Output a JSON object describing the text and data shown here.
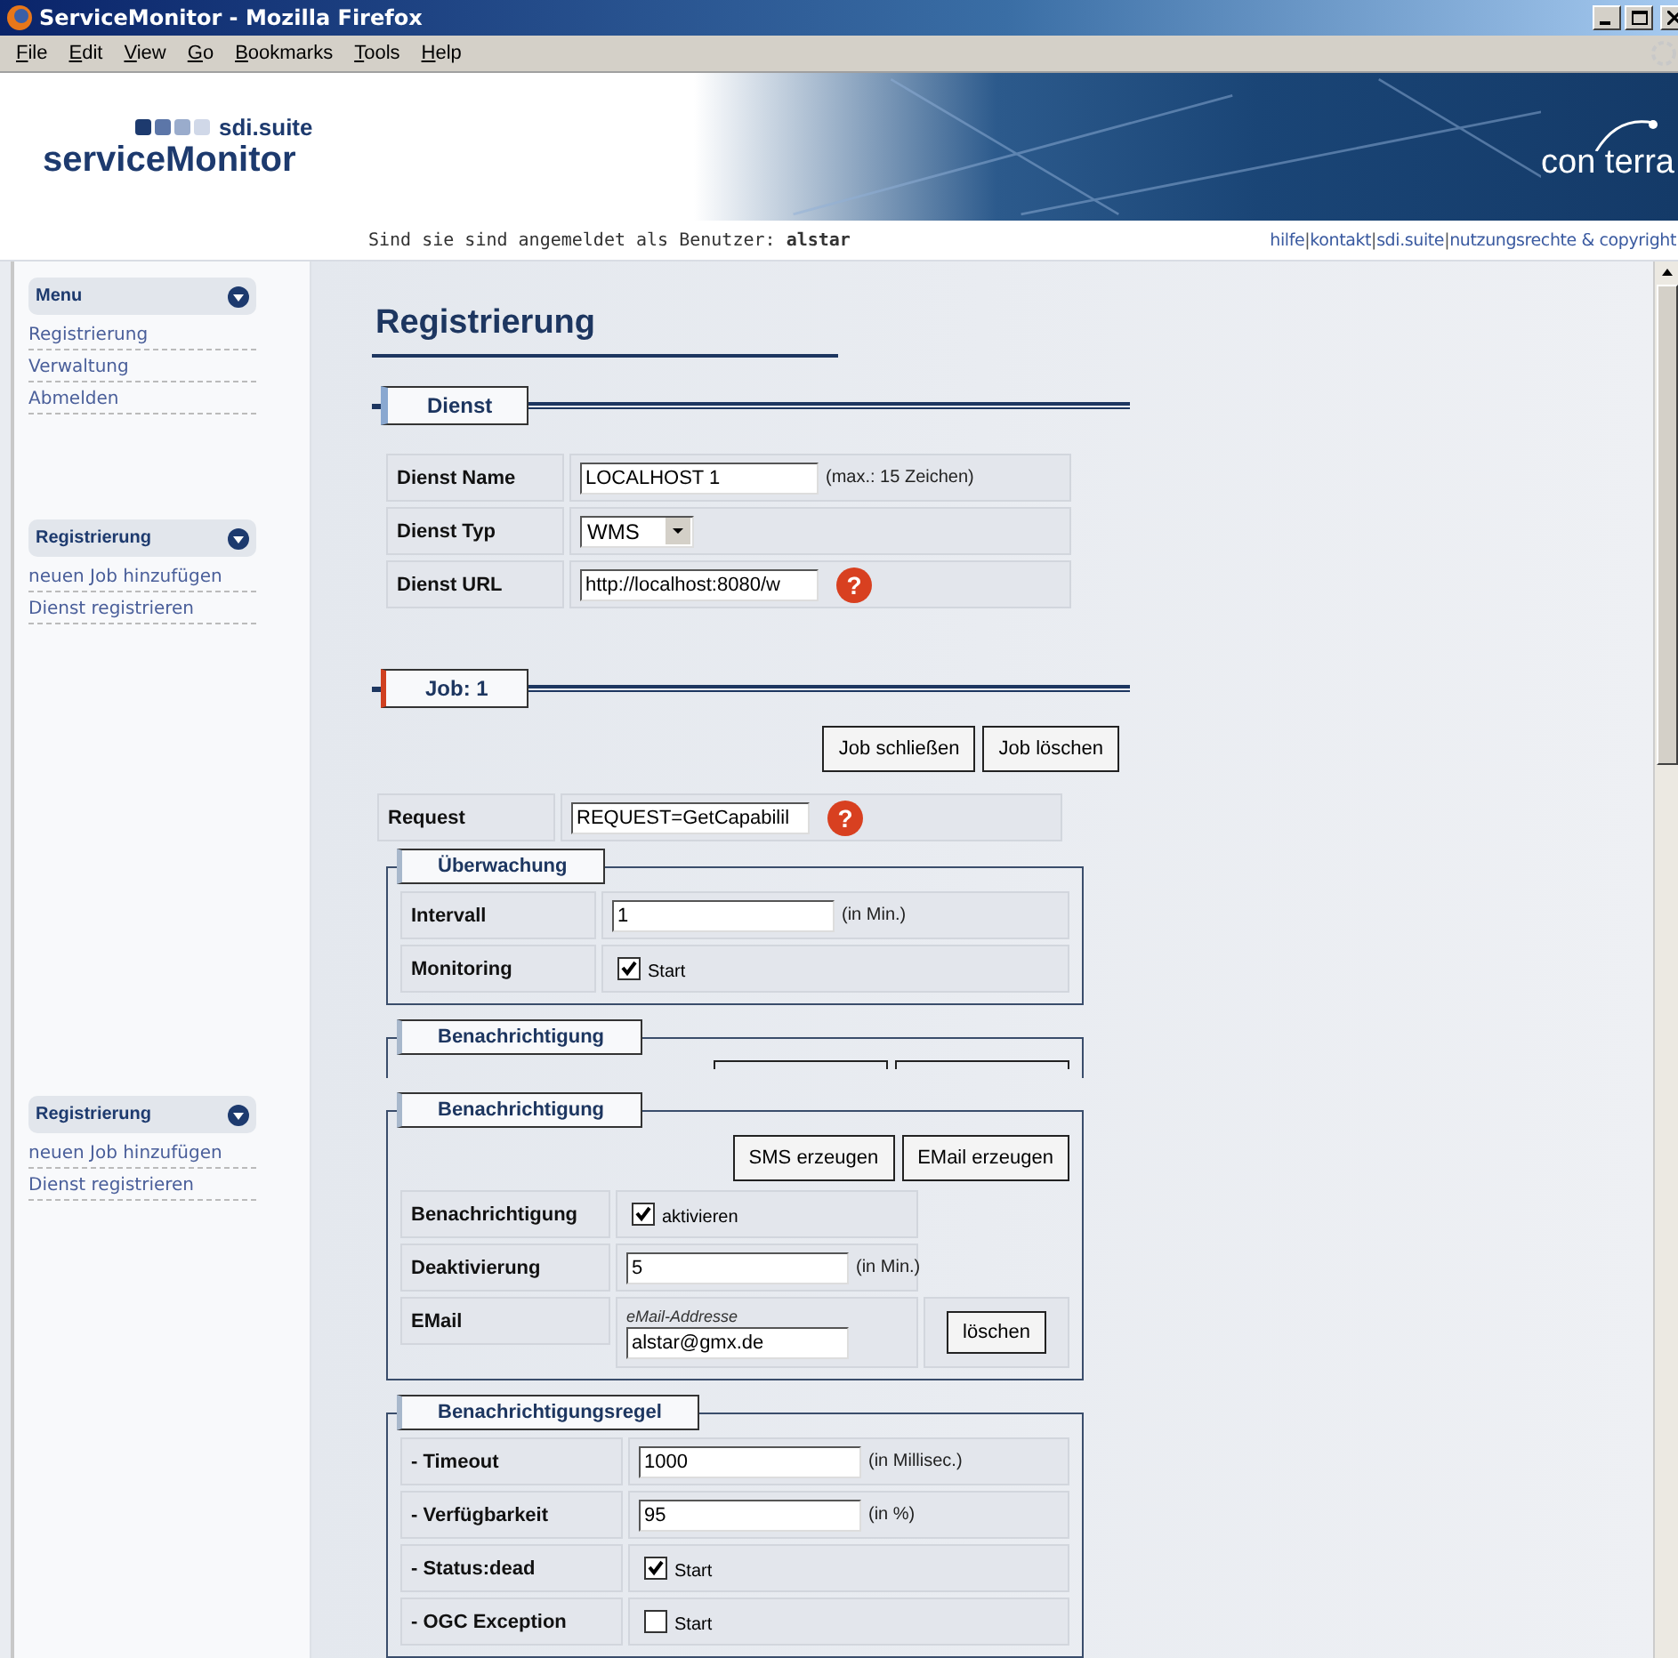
{
  "window": {
    "title": "ServiceMonitor - Mozilla Firefox"
  },
  "menu_bar": [
    "File",
    "Edit",
    "View",
    "Go",
    "Bookmarks",
    "Tools",
    "Help"
  ],
  "header": {
    "brand_top": "sdi.suite",
    "brand": "serviceMonitor",
    "partner_logo": "con terra",
    "login_text": "Sind sie sind angemeldet als Benutzer:",
    "user": "alstar",
    "separator": "|",
    "links": [
      "hilfe",
      "kontakt",
      "sdi.suite",
      "nutzungsrechte & copyright"
    ]
  },
  "sidebar": [
    {
      "title": "Menu",
      "items": [
        "Registrierung",
        "Verwaltung",
        "Abmelden"
      ]
    },
    {
      "title": "Registrierung",
      "items": [
        "neuen Job hinzufügen",
        "Dienst registrieren"
      ]
    },
    {
      "title": "Registrierung",
      "items": [
        "neuen Job hinzufügen",
        "Dienst registrieren"
      ]
    }
  ],
  "page_title": "Registrierung",
  "dienst": {
    "legend": "Dienst",
    "rows": [
      {
        "label": "Dienst Name",
        "kind": "text",
        "value": "LOCALHOST 1",
        "hint": "(max.: 15 Zeichen)"
      },
      {
        "label": "Dienst Typ",
        "kind": "select",
        "value": "WMS"
      },
      {
        "label": "Dienst URL",
        "kind": "text",
        "value": "http://localhost:8080/w",
        "help": "?"
      }
    ]
  },
  "job": {
    "legend": "Job: 1",
    "buttons": [
      "Job schließen",
      "Job löschen"
    ],
    "request": {
      "label": "Request",
      "value": "REQUEST=GetCapabilil",
      "help": "?"
    },
    "groups": [
      {
        "kind": "full",
        "legend": "Überwachung",
        "rows": [
          {
            "label": "Intervall",
            "kind": "text",
            "value": "1",
            "hint": "(in Min.)"
          },
          {
            "label": "Monitoring",
            "kind": "check",
            "checked": true,
            "text": "Start"
          }
        ]
      },
      {
        "kind": "partial",
        "legend": "Benachrichtigung"
      },
      {
        "kind": "full",
        "legend": "Benachrichtigung",
        "buttons": [
          "SMS erzeugen",
          "EMail erzeugen"
        ],
        "rows": [
          {
            "label": "Benachrichtigung",
            "kind": "check",
            "checked": true,
            "text": "aktivieren"
          },
          {
            "label": "Deaktivierung",
            "kind": "text",
            "value": "5",
            "hint": "(in Min.)"
          },
          {
            "label": "EMail",
            "kind": "email",
            "caption": "eMail-Addresse",
            "value": "alstar@gmx.de",
            "button": "löschen"
          }
        ]
      },
      {
        "kind": "full",
        "legend": "Benachrichtigungsregel",
        "rows": [
          {
            "label": "- Timeout",
            "kind": "text",
            "value": "1000",
            "hint": "(in Millisec.)"
          },
          {
            "label": "- Verfügbarkeit",
            "kind": "text",
            "value": "95",
            "hint": "(in %)"
          },
          {
            "label": "- Status:dead",
            "kind": "check",
            "checked": true,
            "text": "Start"
          },
          {
            "label": "- OGC Exception",
            "kind": "check",
            "checked": false,
            "text": "Start"
          }
        ]
      }
    ]
  }
}
